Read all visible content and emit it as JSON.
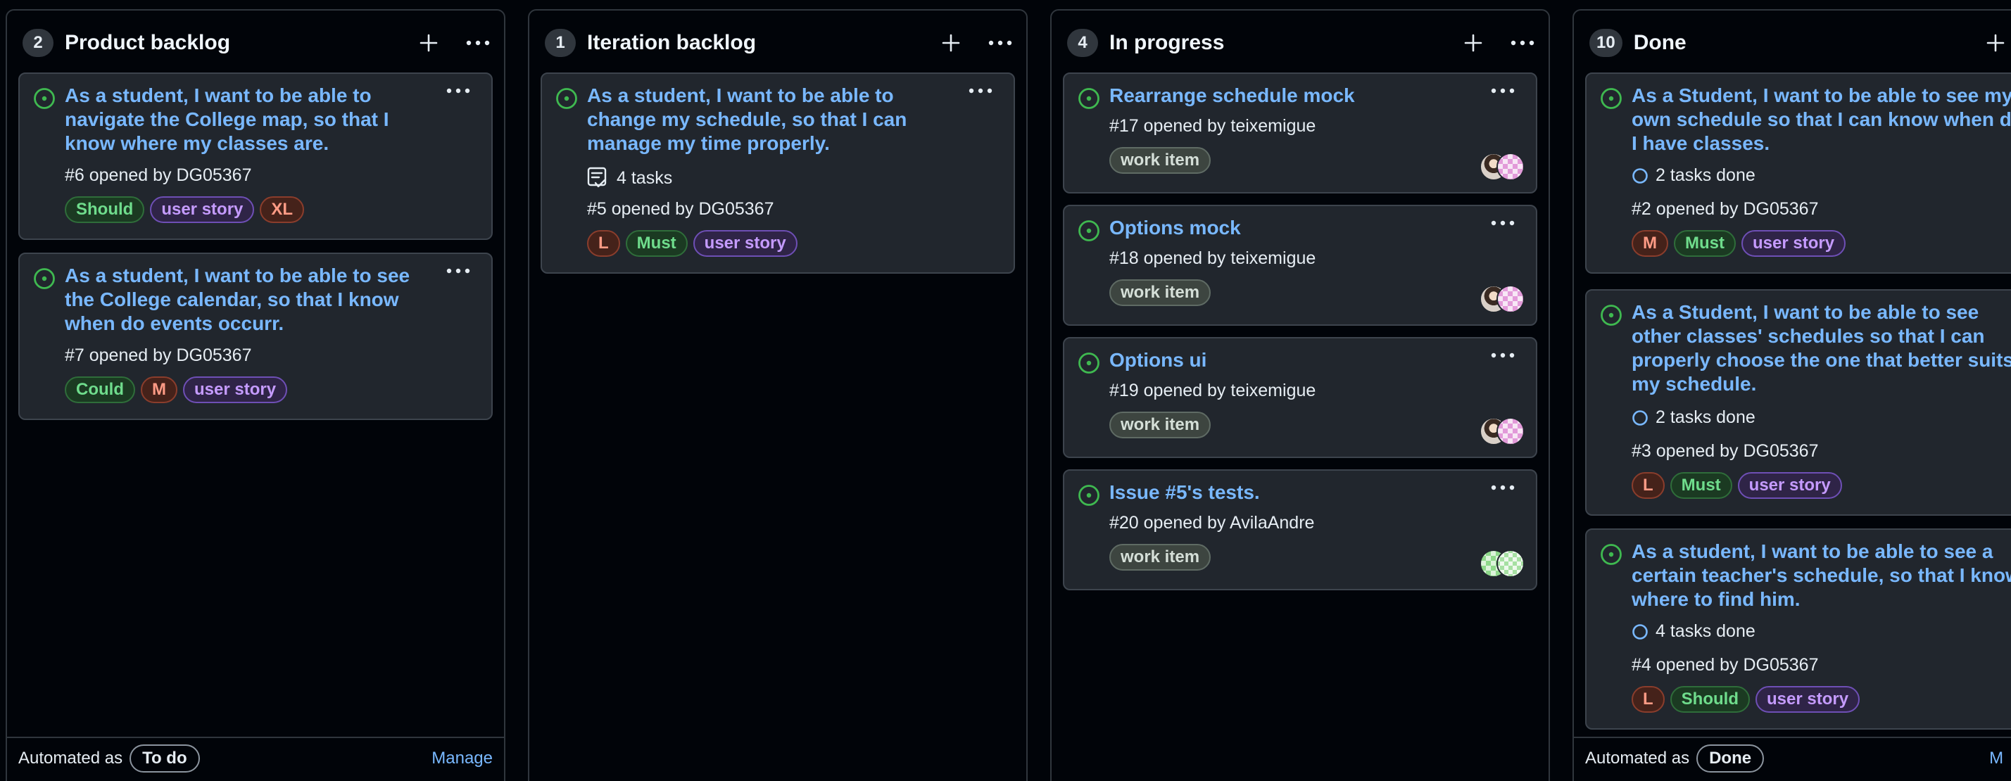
{
  "columns": [
    {
      "count": "2",
      "title": "Product backlog",
      "footer": {
        "automated_label": "Automated as",
        "automation": "To do",
        "manage": "Manage"
      },
      "cards": [
        {
          "title": "As a student, I want to be able to navigate the College map, so that I know where my classes are.",
          "meta": "#6 opened by DG05367",
          "labels": [
            "Should",
            "user story",
            "XL"
          ]
        },
        {
          "title": "As a student, I want to be able to see the College calendar, so that I know when do events occurr.",
          "meta": "#7 opened by DG05367",
          "labels": [
            "Could",
            "M",
            "user story"
          ]
        }
      ]
    },
    {
      "count": "1",
      "title": "Iteration backlog",
      "cards": [
        {
          "title": "As a student, I want to be able to change my schedule, so that I can manage my time properly.",
          "tasks": "4 tasks",
          "meta": "#5 opened by DG05367",
          "labels": [
            "L",
            "Must",
            "user story"
          ]
        }
      ]
    },
    {
      "count": "4",
      "title": "In progress",
      "cards": [
        {
          "title": "Rearrange schedule mock",
          "meta": "#17 opened by teixemigue",
          "labels": [
            "work item"
          ]
        },
        {
          "title": "Options mock",
          "meta": "#18 opened by teixemigue",
          "labels": [
            "work item"
          ]
        },
        {
          "title": "Options ui",
          "meta": "#19 opened by teixemigue",
          "labels": [
            "work item"
          ]
        },
        {
          "title": "Issue #5's tests.",
          "meta": "#20 opened by AvilaAndre",
          "labels": [
            "work item"
          ]
        }
      ]
    },
    {
      "count": "10",
      "title": "Done",
      "footer": {
        "automated_label": "Automated as",
        "automation": "Done",
        "manage": "M"
      },
      "cards": [
        {
          "title": "As a Student, I want to be able to see my own schedule so that I can know when do I have classes.",
          "tasks": "2 tasks done",
          "meta": "#2 opened by DG05367",
          "labels": [
            "M",
            "Must",
            "user story"
          ]
        },
        {
          "title": "As a Student, I want to be able to see other classes' schedules so that I can properly choose the one that better suits my schedule.",
          "tasks": "2 tasks done",
          "meta": "#3 opened by DG05367",
          "labels": [
            "L",
            "Must",
            "user story"
          ]
        },
        {
          "title": "As a student, I want to be able to see a certain teacher's schedule, so that I know where to find him.",
          "tasks": "4 tasks done",
          "meta": "#4 opened by DG05367",
          "labels": [
            "L",
            "Should",
            "user story"
          ]
        }
      ]
    }
  ],
  "colors": {
    "background": "#010409",
    "card": "#21262d",
    "title_link": "#79b8ff",
    "open_status": "#3fb950",
    "label_green": "#6fdc8c",
    "label_purple": "#c59bff",
    "label_orange": "#ff9b85"
  },
  "icons": {
    "open_issue": "issue-opened-icon",
    "tasks": "tasklist-icon",
    "tasks_done": "progress-circle-icon",
    "add": "plus-icon",
    "more": "kebab-horizontal-icon"
  }
}
